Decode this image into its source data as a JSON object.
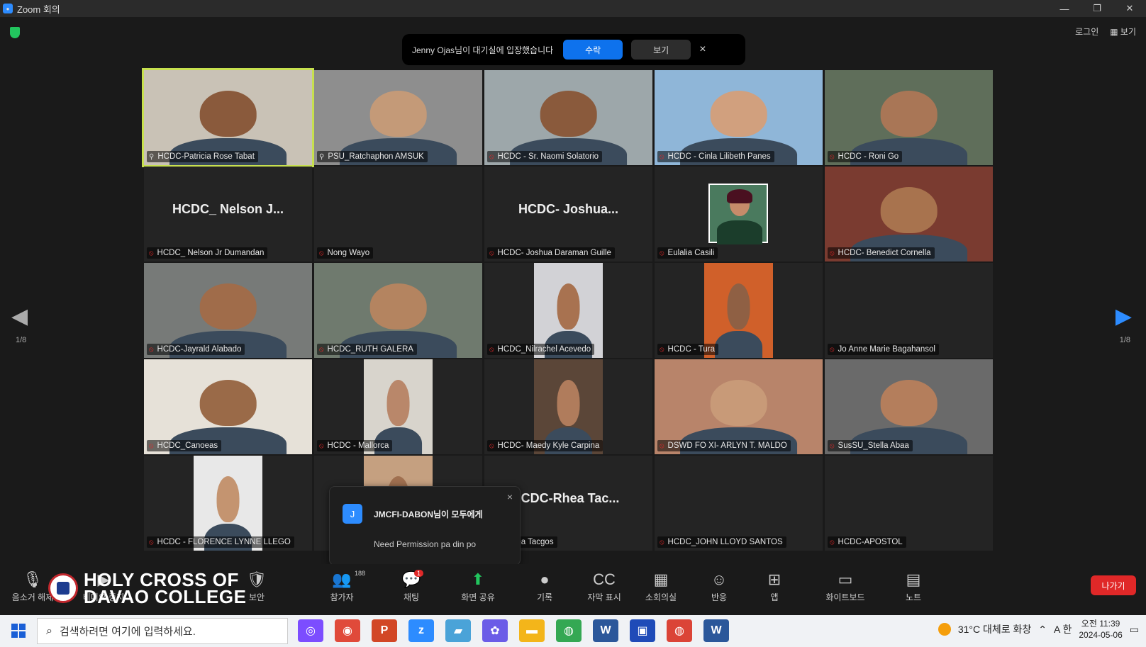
{
  "window": {
    "title": "Zoom 회의",
    "controls": [
      "—",
      "❐",
      "✕"
    ]
  },
  "topright": {
    "login": "로그인",
    "view": "▦ 보기"
  },
  "notification": {
    "text": "Jenny Ojas님이 대기실에 입장했습니다",
    "admit": "수락",
    "view": "보기",
    "close": "×"
  },
  "grid": {
    "tiles": [
      {
        "label": "HCDC-Patricia Rose Tabat",
        "video": true,
        "active": true,
        "pinned": true,
        "skin": "#8a5a3c",
        "bg": "#c9c2b6"
      },
      {
        "label": "PSU_Ratchaphon AMSUK",
        "video": true,
        "pinned": true,
        "skin": "#c49a78",
        "bg": "#8e8e8e"
      },
      {
        "label": "HCDC - Sr. Naomi Solatorio",
        "video": true,
        "skin": "#8a5a3c",
        "bg": "#9da7aa"
      },
      {
        "label": "HCDC - Cinla Lilibeth Panes",
        "video": true,
        "skin": "#d1a07e",
        "bg": "#8fb6d8"
      },
      {
        "label": "HCDC - Roni Go",
        "video": true,
        "skin": "#a97656",
        "bg": "#5f6e5a"
      },
      {
        "label": "HCDC_ Nelson Jr Dumandan",
        "video": false,
        "bigname": "HCDC_ Nelson J..."
      },
      {
        "label": "Nong Wayo",
        "video": false,
        "bigname": ""
      },
      {
        "label": "HCDC- Joshua Daraman Guille",
        "video": false,
        "bigname": "HCDC- Joshua..."
      },
      {
        "label": "Eulalia Casili",
        "video": false,
        "avatar": true
      },
      {
        "label": "HCDC- Benedict Cornella",
        "video": true,
        "skin": "#a8734e",
        "bg": "#7a3b30"
      },
      {
        "label": "HCDC-Jayrald Alabado",
        "video": true,
        "skin": "#a06c4a",
        "bg": "#777a78"
      },
      {
        "label": "HCDC_RUTH GALERA",
        "video": true,
        "skin": "#b48460",
        "bg": "#6f7a6e"
      },
      {
        "label": "HCDC_Nilrachel Acevedo",
        "video": true,
        "skin": "#a87250",
        "bg": "#d2d2d6",
        "narrow": true
      },
      {
        "label": "HCDC - Tura",
        "video": true,
        "skin": "#8f6044",
        "bg": "#d0602a",
        "narrow": true
      },
      {
        "label": "Jo Anne Marie Bagahansol",
        "video": false,
        "bigname": ""
      },
      {
        "label": "HCDC_Canoeas",
        "video": true,
        "skin": "#9a6a48",
        "bg": "#e6e1d8"
      },
      {
        "label": "HCDC - Mallorca",
        "video": true,
        "skin": "#b9876a",
        "bg": "#d8d4cc",
        "narrow": true
      },
      {
        "label": "HCDC- Maedy Kyle Carpina",
        "video": true,
        "skin": "#b07c5c",
        "bg": "#5b4638",
        "narrow": true
      },
      {
        "label": "DSWD FO XI- ARLYN T. MALDO",
        "video": true,
        "skin": "#c89a78",
        "bg": "#b8846a"
      },
      {
        "label": "SusSU_Stella Abaa",
        "video": true,
        "skin": "#b47e5c",
        "bg": "#6a6a6a"
      },
      {
        "label": "HCDC - FLORENCE LYNNE LLEGO",
        "video": true,
        "skin": "#c49470",
        "bg": "#e8e8e8",
        "narrow": true
      },
      {
        "label": "",
        "video": true,
        "skin": "#a07050",
        "bg": "#c5a080",
        "narrow": true
      },
      {
        "label": "C-Rhea Tacgos",
        "video": false,
        "bigname": "ICDC-Rhea  Tac..."
      },
      {
        "label": "HCDC_JOHN LLOYD SANTOS",
        "video": false,
        "bigname": ""
      },
      {
        "label": "HCDC-APOSTOL",
        "video": false,
        "bigname": ""
      }
    ]
  },
  "chat_popup": {
    "sender": "JMCFI-DABON님이 모두에게",
    "message": "Need Permission pa din po",
    "avatar": "J",
    "close": "×"
  },
  "pagination": {
    "left": "1/8",
    "right": "1/8"
  },
  "toolbar": {
    "items": [
      {
        "label": "음소거 해제",
        "icon": "🎙"
      },
      {
        "label": "비디오 중지",
        "icon": "▶"
      },
      {
        "label": "보안",
        "icon": "🛡"
      },
      {
        "label": "참가자",
        "icon": "👥",
        "count": "188"
      },
      {
        "label": "채팅",
        "icon": "💬",
        "badge": "1"
      },
      {
        "label": "화면 공유",
        "icon": "⬆"
      },
      {
        "label": "기록",
        "icon": "●"
      },
      {
        "label": "자막 표시",
        "icon": "CC"
      },
      {
        "label": "소회의실",
        "icon": "▦"
      },
      {
        "label": "반응",
        "icon": "☺"
      },
      {
        "label": "앱",
        "icon": "⊞"
      },
      {
        "label": "화이트보드",
        "icon": "▭"
      },
      {
        "label": "노트",
        "icon": "▤"
      }
    ],
    "leave": "나가기"
  },
  "logo": {
    "line1": "HOLY CROSS OF",
    "line2": "DAVAO COLLEGE"
  },
  "taskbar": {
    "search_placeholder": "검색하려면 여기에 입력하세요.",
    "weather": "31°C  대체로 화창",
    "time": "오전 11:39",
    "date": "2024-05-06",
    "lang": "A  한"
  }
}
